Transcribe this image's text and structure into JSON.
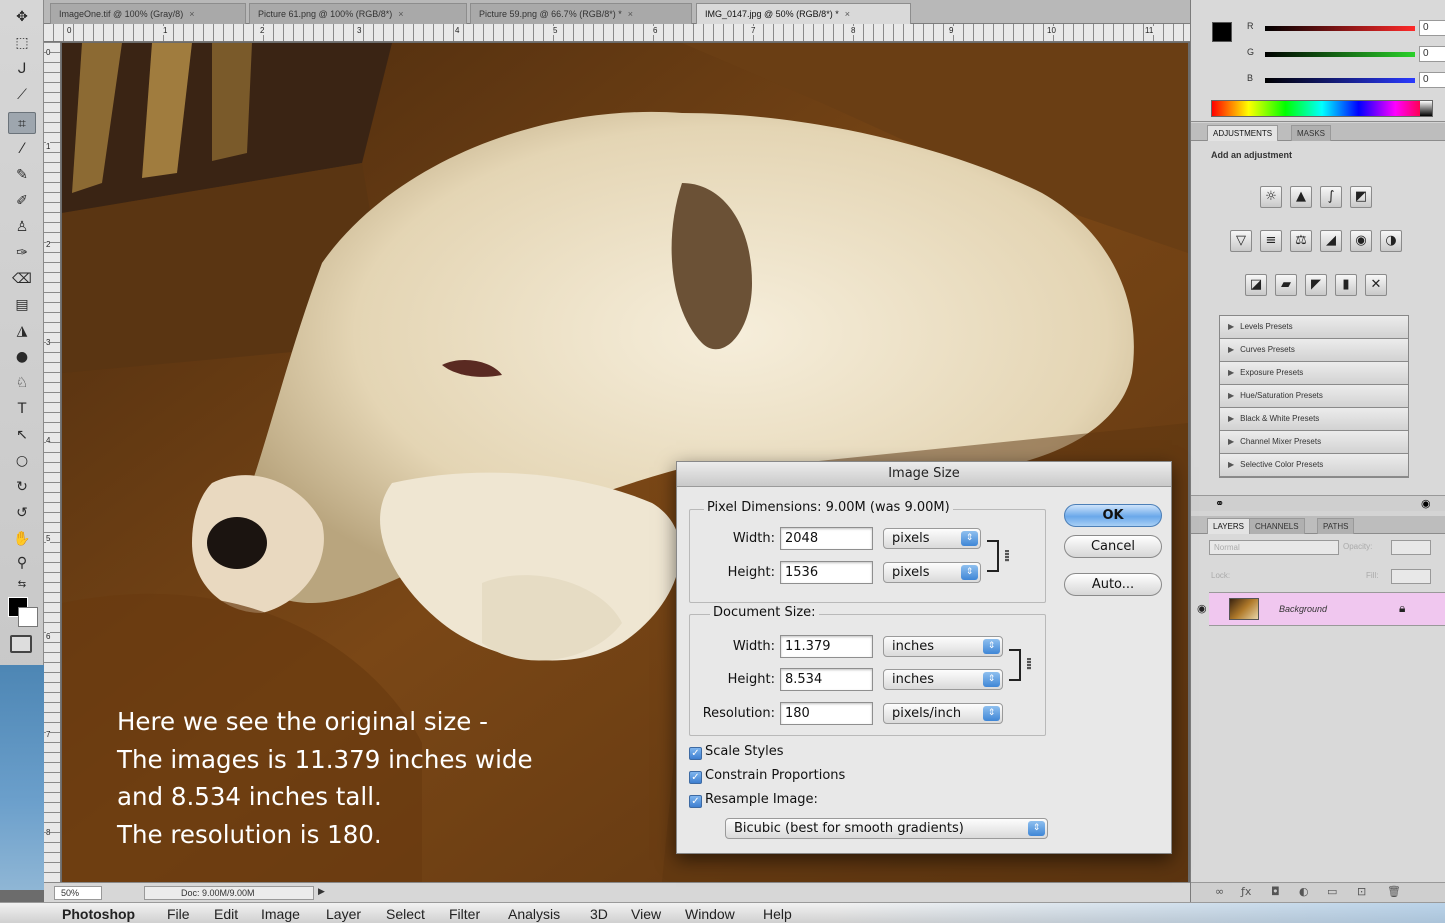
{
  "document_tabs": [
    {
      "label": "ImageOne.tif @ 100% (Gray/8)"
    },
    {
      "label": "Picture 61.png @ 100% (RGB/8*)"
    },
    {
      "label": "Picture 59.png @ 66.7% (RGB/8*) *"
    },
    {
      "label": "IMG_0147.jpg @ 50% (RGB/8*) *"
    }
  ],
  "ruler_h_numbers": [
    "0",
    "1",
    "2",
    "3",
    "4",
    "5",
    "6",
    "7",
    "8",
    "9",
    "10",
    "11"
  ],
  "ruler_v_numbers": [
    "0",
    "1",
    "2",
    "3",
    "4",
    "5",
    "6",
    "7",
    "8"
  ],
  "caption": {
    "line1": "Here we see the original size -",
    "line2": "The images is 11.379 inches wide",
    "line3": "and 8.534 inches tall.",
    "line4": "The resolution is 180."
  },
  "status": {
    "zoom": "50%",
    "doc_info": "Doc: 9.00M/9.00M"
  },
  "menubar": {
    "app": "Photoshop",
    "items": [
      "File",
      "Edit",
      "Image",
      "Layer",
      "Select",
      "Filter",
      "Analysis",
      "3D",
      "View",
      "Window",
      "Help"
    ]
  },
  "color_panel": {
    "channels": [
      {
        "label": "R",
        "value": "0",
        "color": "#ff2a2a"
      },
      {
        "label": "G",
        "value": "0",
        "color": "#2ad12a"
      },
      {
        "label": "B",
        "value": "0",
        "color": "#2a3aff"
      }
    ]
  },
  "adjustments_panel": {
    "tabs": [
      "ADJUSTMENTS",
      "MASKS"
    ],
    "subtitle": "Add an adjustment",
    "icons_row1": [
      "brightness-contrast-icon",
      "levels-icon",
      "curves-icon",
      "exposure-icon"
    ],
    "icons_row2": [
      "vibrance-icon",
      "hue-saturation-icon",
      "color-balance-icon",
      "black-white-icon",
      "photo-filter-icon",
      "channel-mixer-icon"
    ],
    "icons_row3": [
      "invert-icon",
      "posterize-icon",
      "threshold-icon",
      "gradient-map-icon",
      "selective-color-icon"
    ],
    "presets": [
      "Levels Presets",
      "Curves Presets",
      "Exposure Presets",
      "Hue/Saturation Presets",
      "Black & White Presets",
      "Channel Mixer Presets",
      "Selective Color Presets"
    ]
  },
  "layers_panel": {
    "tabs": [
      "LAYERS",
      "CHANNELS",
      "PATHS"
    ],
    "blend_mode": "Normal",
    "opacity_label": "Opacity:",
    "lock_label": "Lock:",
    "fill_label": "Fill:",
    "layer_name": "Background",
    "layer_row_color": "#f0c7ef"
  },
  "dialog": {
    "title": "Image Size",
    "pixel_dimensions_label": "Pixel Dimensions:  9.00M (was 9.00M)",
    "pixel_width_label": "Width:",
    "pixel_width_value": "2048",
    "pixel_width_unit": "pixels",
    "pixel_height_label": "Height:",
    "pixel_height_value": "1536",
    "pixel_height_unit": "pixels",
    "document_size_label": "Document Size:",
    "doc_width_label": "Width:",
    "doc_width_value": "11.379",
    "doc_width_unit": "inches",
    "doc_height_label": "Height:",
    "doc_height_value": "8.534",
    "doc_height_unit": "inches",
    "resolution_label": "Resolution:",
    "resolution_value": "180",
    "resolution_unit": "pixels/inch",
    "scale_styles": "Scale Styles",
    "constrain_proportions": "Constrain Proportions",
    "resample_image": "Resample Image:",
    "resample_method": "Bicubic (best for smooth gradients)",
    "ok": "OK",
    "cancel": "Cancel",
    "auto": "Auto..."
  }
}
